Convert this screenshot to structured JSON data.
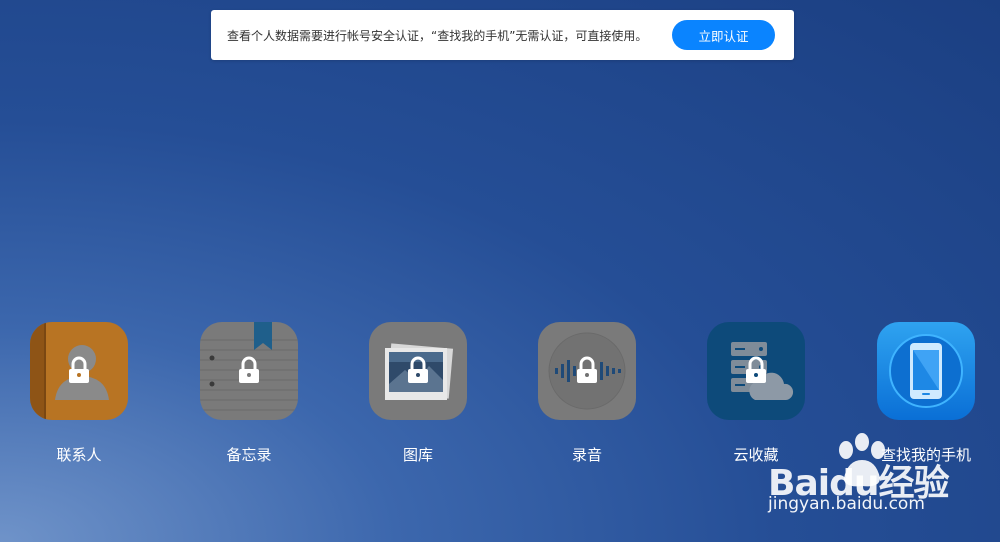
{
  "notice": {
    "text": "查看个人数据需要进行帐号安全认证，“查找我的手机”无需认证，可直接使用。",
    "button_label": "立即认证"
  },
  "apps": [
    {
      "label": "联系人",
      "icon": "contacts-icon",
      "locked": true
    },
    {
      "label": "备忘录",
      "icon": "notes-icon",
      "locked": true
    },
    {
      "label": "图库",
      "icon": "gallery-icon",
      "locked": true
    },
    {
      "label": "录音",
      "icon": "recorder-icon",
      "locked": true
    },
    {
      "label": "云收藏",
      "icon": "cloud-favorites-icon",
      "locked": true
    },
    {
      "label": "查找我的手机",
      "icon": "find-my-phone-icon",
      "locked": false
    }
  ],
  "watermark": {
    "brand": "Baidu经验",
    "url": "jingyan.baidu.com"
  },
  "colors": {
    "accent": "#0a84ff",
    "background": "#254e96"
  }
}
